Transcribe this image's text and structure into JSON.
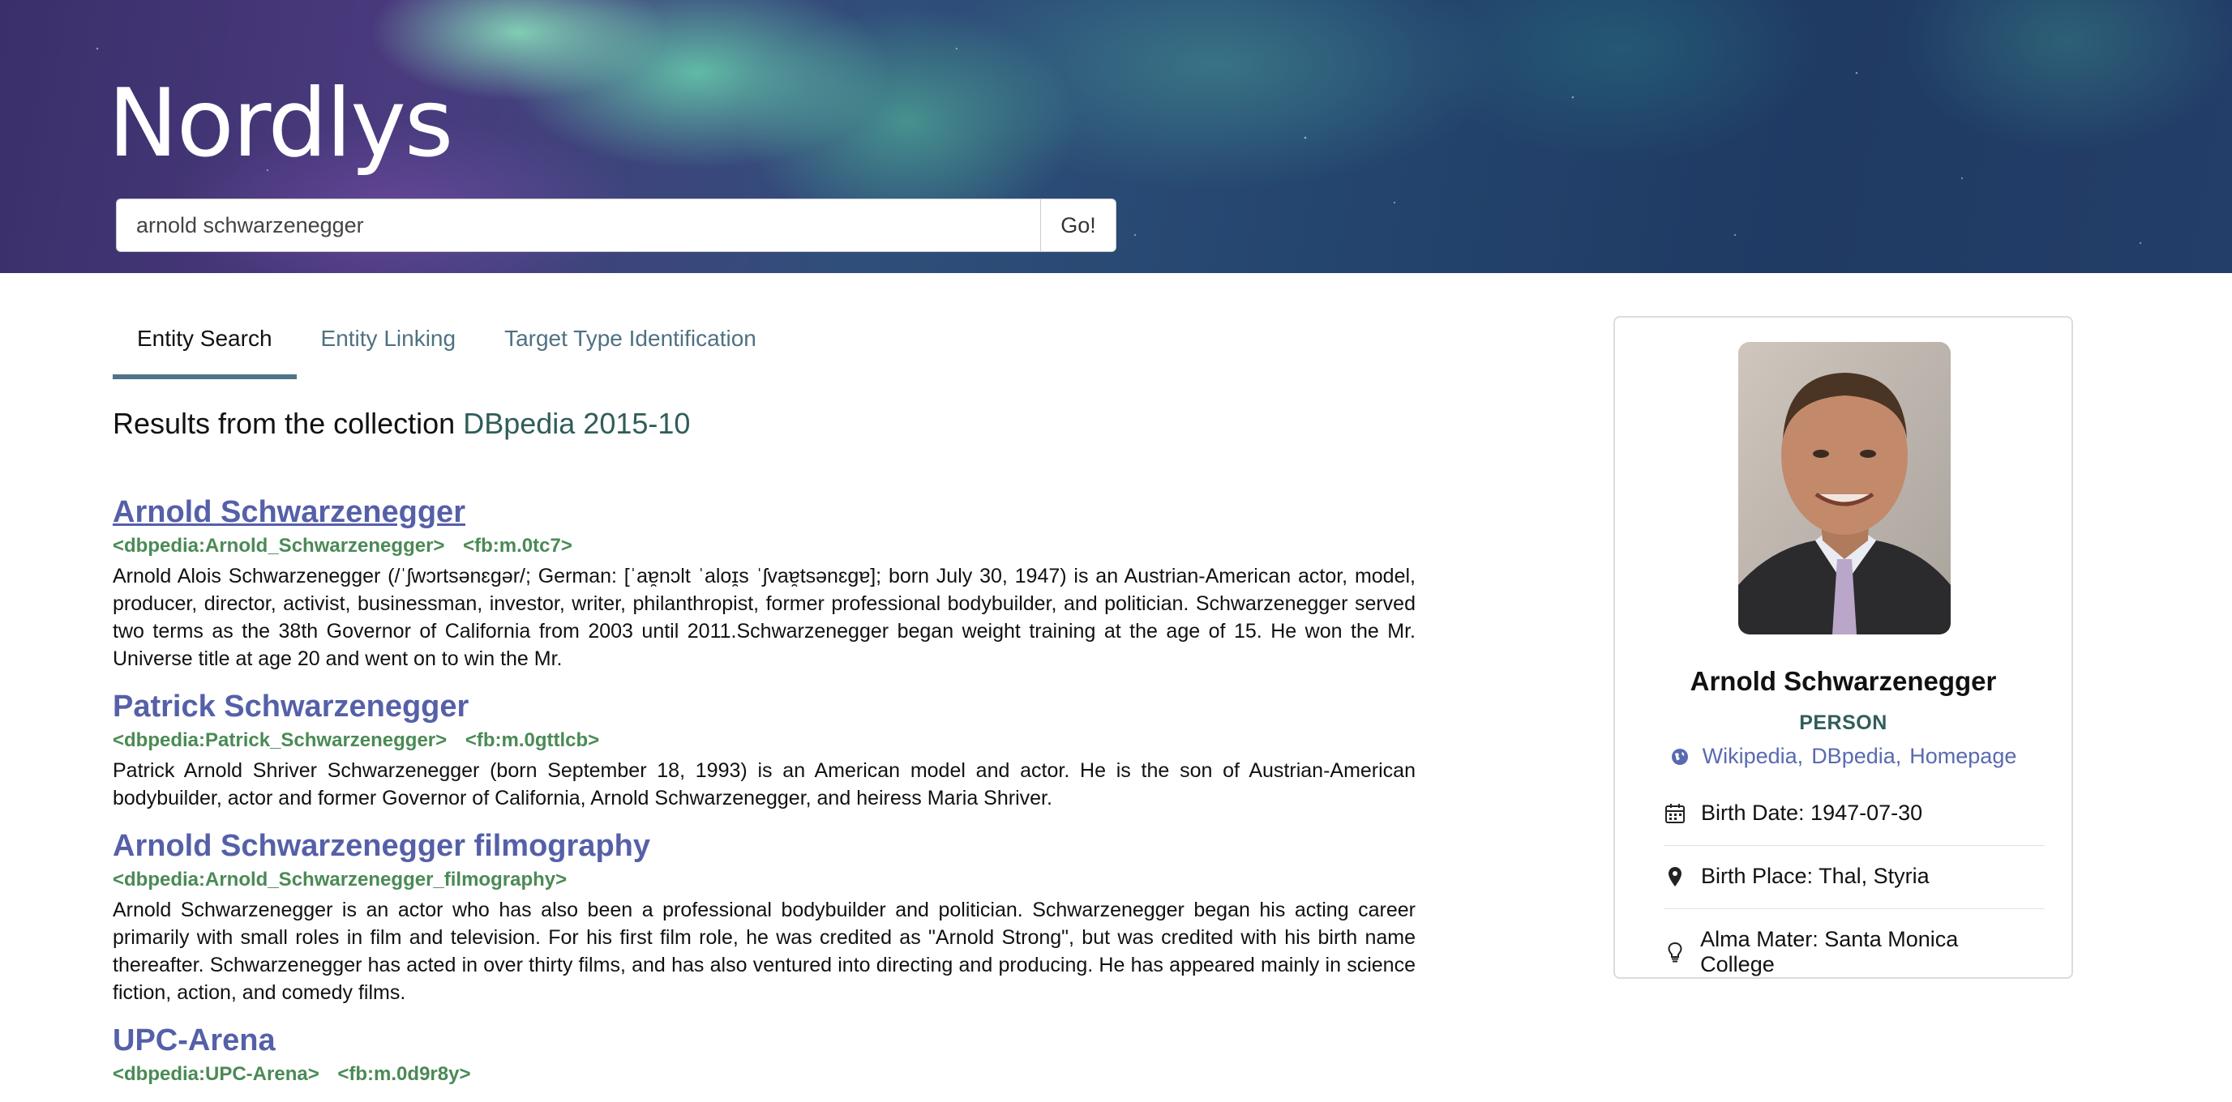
{
  "header": {
    "logo": "Nordlys",
    "search_value": "arnold schwarzenegger",
    "search_button": "Go!"
  },
  "tabs": [
    {
      "label": "Entity Search",
      "active": true
    },
    {
      "label": "Entity Linking",
      "active": false
    },
    {
      "label": "Target Type Identification",
      "active": false
    }
  ],
  "collection": {
    "prefix": "Results from the collection",
    "name": "DBpedia 2015-10"
  },
  "results": [
    {
      "title": "Arnold Schwarzenegger",
      "dbpedia": "<dbpedia:Arnold_Schwarzenegger>",
      "fb": "<fb:m.0tc7>",
      "abstract": "Arnold Alois Schwarzenegger (/ˈʃwɔrtsənɛɡər/; German: [ˈaɐ̯nɔlt ˈaloɪ̯s ˈʃvaɐ̯tsənɛɡɐ]; born July 30, 1947) is an Austrian-American actor, model, producer, director, activist, businessman, investor, writer, philanthropist, former professional bodybuilder, and politician. Schwarzenegger served two terms as the 38th Governor of California from 2003 until 2011.Schwarzenegger began weight training at the age of 15. He won the Mr. Universe title at age 20 and went on to win the Mr."
    },
    {
      "title": "Patrick Schwarzenegger",
      "dbpedia": "<dbpedia:Patrick_Schwarzenegger>",
      "fb": "<fb:m.0gttlcb>",
      "abstract": "Patrick Arnold Shriver Schwarzenegger (born September 18, 1993) is an American model and actor. He is the son of Austrian-American bodybuilder, actor and former Governor of California, Arnold Schwarzenegger, and heiress Maria Shriver."
    },
    {
      "title": "Arnold Schwarzenegger filmography",
      "dbpedia": "<dbpedia:Arnold_Schwarzenegger_filmography>",
      "fb": "",
      "abstract": "Arnold Schwarzenegger is an actor who has also been a professional bodybuilder and politician. Schwarzenegger began his acting career primarily with small roles in film and television. For his first film role, he was credited as \"Arnold Strong\", but was credited with his birth name thereafter. Schwarzenegger has acted in over thirty films, and has also ventured into directing and producing. He has appeared mainly in science fiction, action, and comedy films."
    },
    {
      "title": "UPC-Arena",
      "dbpedia": "<dbpedia:UPC-Arena>",
      "fb": "<fb:m.0d9r8y>",
      "abstract": ""
    }
  ],
  "card": {
    "name": "Arnold Schwarzenegger",
    "type": "PERSON",
    "links": [
      "Wikipedia,",
      "DBpedia,",
      "Homepage"
    ],
    "facts": [
      {
        "icon": "calendar-icon",
        "text": "Birth Date: 1947-07-30"
      },
      {
        "icon": "map-marker-icon",
        "text": "Birth Place: Thal, Styria"
      },
      {
        "icon": "lightbulb-icon",
        "text": "Alma Mater: Santa Monica College"
      }
    ]
  },
  "colors": {
    "link": "#5560a8",
    "id_green": "#4a8a55",
    "collection": "#2f5d5a",
    "tab_underline": "#4f7487"
  }
}
